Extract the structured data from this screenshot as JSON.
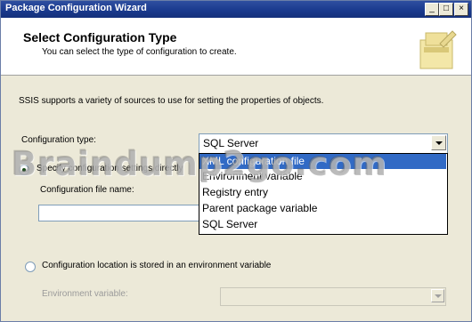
{
  "window": {
    "title": "Package Configuration Wizard",
    "minimize_label": "_",
    "maximize_label": "□",
    "close_label": "×"
  },
  "header": {
    "title": "Select Configuration Type",
    "subtitle": "You can select the type of configuration to create."
  },
  "body": {
    "intro": "SSIS supports a variety of sources to use for setting the properties of objects.",
    "config_type_label": "Configuration type:",
    "config_type_value": "SQL Server",
    "options": [
      "XML configuration file",
      "Environment variable",
      "Registry entry",
      "Parent package variable",
      "SQL Server"
    ],
    "highlighted_option_index": 0,
    "radio_specify_label": "Specify configuration settings directly",
    "config_file_label": "Configuration file name:",
    "radio_env_label": "Configuration location is stored in an environment variable",
    "env_var_label": "Environment variable:"
  },
  "watermark": "Braindump2go.com",
  "colors": {
    "titlebar": "#1a3a8e",
    "selection": "#316ac5",
    "dialog_bg": "#ece9d8"
  }
}
